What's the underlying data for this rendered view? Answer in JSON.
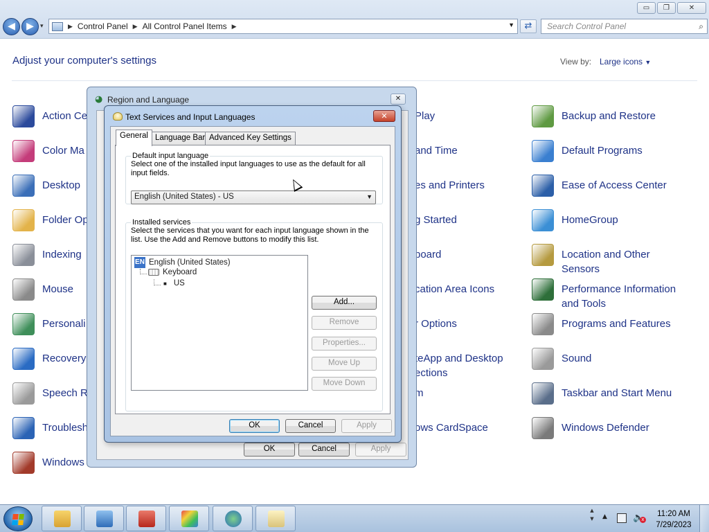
{
  "window": {
    "minimize_glyph": "▭",
    "maximize_glyph": "❐",
    "close_glyph": "✕"
  },
  "nav": {
    "back_glyph": "◀",
    "forward_glyph": "▶",
    "recent_glyph": "▾",
    "breadcrumb": [
      "Control Panel",
      "All Control Panel Items"
    ],
    "search_placeholder": "Search Control Panel"
  },
  "controlpanel": {
    "title": "Adjust your computer's settings",
    "viewby_label": "View by:",
    "viewby_value": "Large icons",
    "col1": [
      "Action Ce",
      "Color Ma",
      "Desktop",
      "Folder Op",
      "Indexing",
      "Mouse",
      "Personali",
      "Recovery",
      "Speech R",
      "Troublesh",
      "Windows"
    ],
    "col2": [
      "Play",
      "and Time",
      "es and Printers",
      "g Started",
      "board",
      "cation Area Icons",
      "r Options",
      "teApp and Desktop\nections",
      "m",
      "ows CardSpace"
    ],
    "col3": [
      "Backup and Restore",
      "Default Programs",
      "Ease of Access Center",
      "HomeGroup",
      "Location and Other\nSensors",
      "Performance Information\nand Tools",
      "Programs and Features",
      "Sound",
      "Taskbar and Start Menu",
      "Windows Defender"
    ],
    "icon_colors": {
      "col1": [
        "#2b4a9c",
        "#c43c7a",
        "#3b6fb8",
        "#e3b34a",
        "#8a8f99",
        "#8a8a8a",
        "#3f8f5a",
        "#2a6bc3",
        "#9a9a9a",
        "#2b63b5",
        "#a23a2a"
      ],
      "col3": [
        "#5f9a42",
        "#3a7fd0",
        "#2c5fa8",
        "#3b8fd5",
        "#b59a3f",
        "#2e6f3a",
        "#8a8a8a",
        "#9a9a9a",
        "#5a6e8a",
        "#7a7a7a"
      ]
    }
  },
  "region_dialog": {
    "title": "Region and Language",
    "ok": "OK",
    "cancel": "Cancel",
    "apply": "Apply"
  },
  "ts_dialog": {
    "title": "Text Services and Input Languages",
    "close_glyph": "✕",
    "tabs": [
      "General",
      "Language Bar",
      "Advanced Key Settings"
    ],
    "default_group": {
      "legend": "Default input language",
      "description": "Select one of the installed input languages to use as the default for all input fields.",
      "selected": "English (United States) - US"
    },
    "services_group": {
      "legend": "Installed services",
      "description": "Select the services that you want for each input language shown in the list. Use the Add and Remove buttons to modify this list.",
      "tree": {
        "badge": "EN",
        "language": "English (United States)",
        "category": "Keyboard",
        "layout": "US"
      },
      "buttons": [
        "Add...",
        "Remove",
        "Properties...",
        "Move Up",
        "Move Down"
      ]
    },
    "ok": "OK",
    "cancel": "Cancel",
    "apply": "Apply"
  },
  "taskbar": {
    "time": "11:20 AM",
    "date": "7/29/2023",
    "tray_up_glyph": "▲",
    "volume_glyph": "🔈",
    "muted_glyph": "x"
  }
}
